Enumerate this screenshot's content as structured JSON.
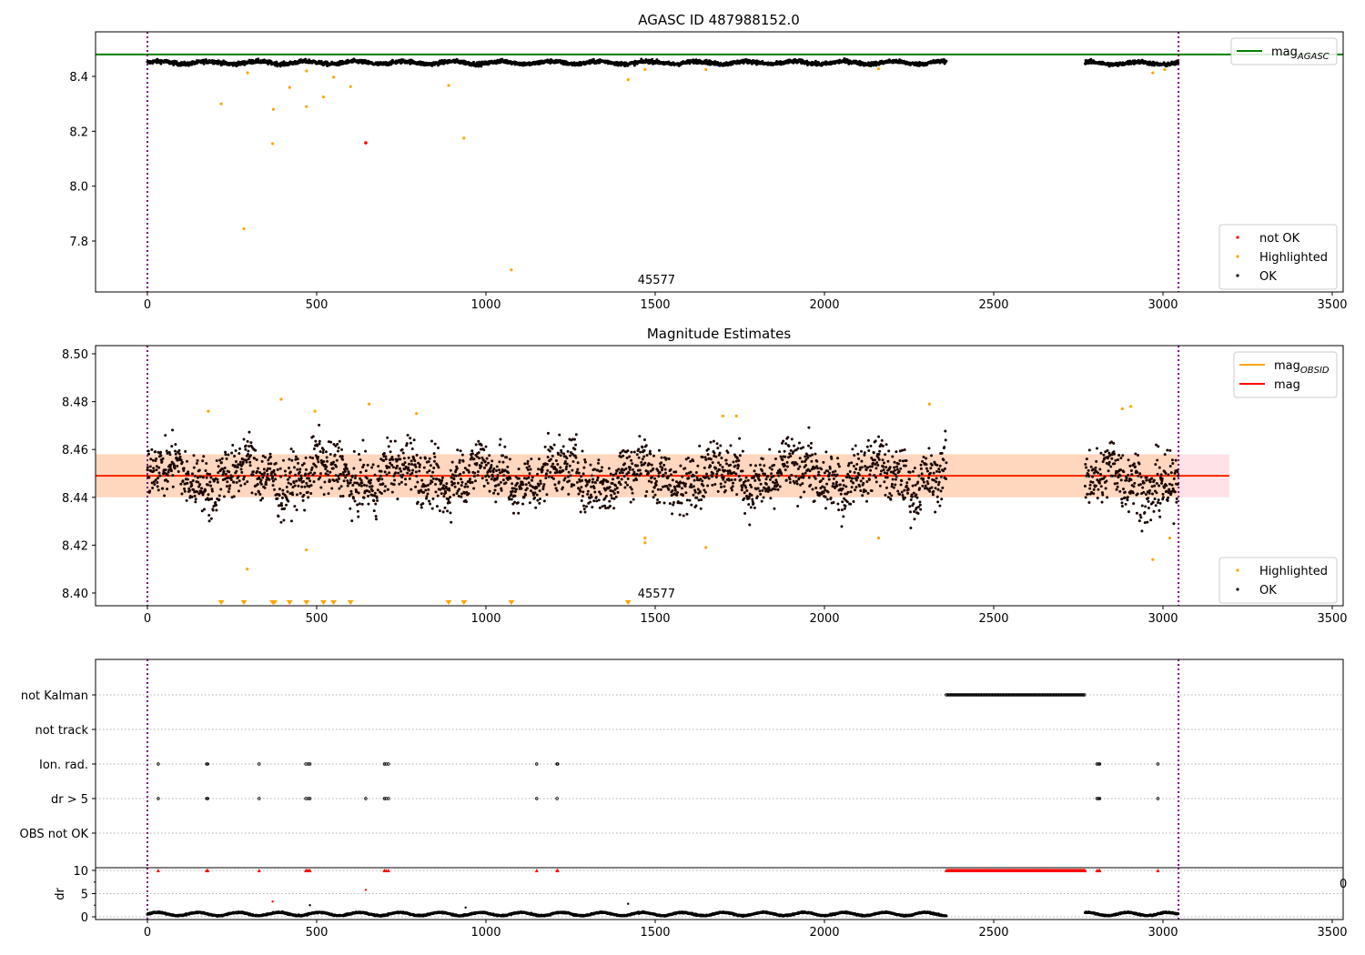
{
  "chart_data": [
    {
      "type": "scatter",
      "title": "AGASC ID 487988152.0",
      "xlim": [
        -150,
        3535
      ],
      "ylim": [
        7.614,
        8.562
      ],
      "xticks": [
        "0",
        "500",
        "1000",
        "1500",
        "2000",
        "2500",
        "3000",
        "3500"
      ],
      "yticks": [
        "7.8",
        "8.0",
        "8.2",
        "8.4"
      ],
      "hline": {
        "name": "mag_AGASC",
        "value": 8.48,
        "color": "#008000"
      },
      "vlines": [
        0,
        3046
      ],
      "annotation": {
        "text": "45577",
        "x": 1450
      },
      "legend_top": [
        {
          "label": "mag",
          "subscript": "AGASC",
          "color": "#008000"
        }
      ],
      "legend_bottom": [
        {
          "label": "not OK",
          "color": "#ff0000"
        },
        {
          "label": "Highlighted",
          "color": "#ffa500"
        },
        {
          "label": "OK",
          "color": "#000000"
        }
      ],
      "ok_segments": [
        {
          "x0": 0,
          "x1": 2360,
          "mean": 8.45,
          "spread": 0.012
        },
        {
          "x0": 2770,
          "x1": 3045,
          "mean": 8.448,
          "spread": 0.012
        }
      ],
      "highlighted": [
        [
          218,
          8.3
        ],
        [
          296,
          8.413
        ],
        [
          372,
          8.28
        ],
        [
          370,
          8.155
        ],
        [
          420,
          8.36
        ],
        [
          470,
          8.29
        ],
        [
          470,
          8.42
        ],
        [
          520,
          8.325
        ],
        [
          550,
          8.397
        ],
        [
          600,
          8.363
        ],
        [
          890,
          8.367
        ],
        [
          935,
          8.175
        ],
        [
          1420,
          8.388
        ],
        [
          285,
          7.845
        ],
        [
          1075,
          7.695
        ],
        [
          1470,
          8.425
        ],
        [
          1650,
          8.425
        ],
        [
          2160,
          8.428
        ],
        [
          2970,
          8.413
        ],
        [
          3005,
          8.425
        ]
      ],
      "not_ok": [
        [
          645,
          8.158
        ]
      ]
    },
    {
      "type": "scatter",
      "title": "Magnitude Estimates",
      "xlim": [
        -150,
        3535
      ],
      "ylim": [
        8.395,
        8.505
      ],
      "xticks": [
        "0",
        "500",
        "1000",
        "1500",
        "2000",
        "2500",
        "3000",
        "3500"
      ],
      "yticks": [
        "8.40",
        "8.42",
        "8.44",
        "8.46",
        "8.48",
        "8.50"
      ],
      "hline": {
        "name": "mag",
        "value": 8.449,
        "color": "#ff0000"
      },
      "band_obsid": {
        "low": 8.44,
        "high": 8.458,
        "x0": 0,
        "x1": 3046,
        "color": "#ffa500"
      },
      "band_mag": {
        "low": 8.44,
        "high": 8.458,
        "x0": -150,
        "x1": 3196,
        "color": "#ff6080"
      },
      "vlines": [
        0,
        3046
      ],
      "annotation": {
        "text": "45577",
        "x": 1450
      },
      "legend_top": [
        {
          "label": "mag",
          "subscript": "OBSID",
          "color": "#ffa500"
        },
        {
          "label": "mag",
          "subscript": "",
          "color": "#ff0000"
        }
      ],
      "legend_bottom": [
        {
          "label": "Highlighted",
          "color": "#ffa500"
        },
        {
          "label": "OK",
          "color": "#000000"
        }
      ],
      "ok_segments": [
        {
          "x0": 0,
          "x1": 2360,
          "mean": 8.449,
          "spread": 0.008
        },
        {
          "x0": 2770,
          "x1": 3045,
          "mean": 8.447,
          "spread": 0.009
        }
      ],
      "highlighted": [
        [
          180,
          8.476
        ],
        [
          395,
          8.481
        ],
        [
          495,
          8.476
        ],
        [
          655,
          8.479
        ],
        [
          795,
          8.475
        ],
        [
          1700,
          8.474
        ],
        [
          1740,
          8.474
        ],
        [
          2310,
          8.479
        ],
        [
          2880,
          8.477
        ],
        [
          2905,
          8.478
        ],
        [
          1470,
          8.423
        ],
        [
          1470,
          8.421
        ],
        [
          1650,
          8.419
        ],
        [
          2160,
          8.423
        ],
        [
          470,
          8.418
        ],
        [
          295,
          8.41
        ],
        [
          2970,
          8.414
        ],
        [
          3020,
          8.423
        ]
      ],
      "below_range_markers": [
        218,
        285,
        370,
        375,
        420,
        470,
        520,
        550,
        600,
        890,
        935,
        1075,
        1420
      ]
    },
    {
      "type": "scatter",
      "categories": [
        "not Kalman",
        "not track",
        "Ion. rad.",
        "dr > 5",
        "OBS not OK"
      ],
      "xlim": [
        -150,
        3535
      ],
      "xticks": [
        "0",
        "500",
        "1000",
        "1500",
        "2000",
        "2500",
        "3000",
        "3500"
      ],
      "flags": {
        "not Kalman": {
          "ranges": [
            [
              2360,
              2770
            ]
          ],
          "points": []
        },
        "not track": {
          "ranges": [],
          "points": []
        },
        "Ion. rad.": {
          "ranges": [],
          "points": [
            32,
            175,
            178,
            330,
            468,
            475,
            480,
            700,
            705,
            712,
            1150,
            1210,
            1212,
            2805,
            2810,
            2813,
            2985
          ]
        },
        "dr > 5": {
          "ranges": [],
          "points": [
            32,
            175,
            178,
            330,
            468,
            475,
            480,
            645,
            700,
            705,
            712,
            1150,
            1210,
            2805,
            2810,
            2813,
            2985
          ]
        },
        "OBS not OK": {
          "ranges": [],
          "points": []
        }
      },
      "dr": {
        "ylabel": "dr",
        "yticks": [
          "0",
          "5",
          "10"
        ],
        "ylim": [
          -0.5,
          10.5
        ],
        "clipped_at_10": {
          "ranges": [
            [
              2360,
              2770
            ]
          ],
          "points": [
            32,
            175,
            178,
            330,
            468,
            472,
            476,
            480,
            700,
            705,
            712,
            1150,
            1210,
            1212,
            2805,
            2810,
            2813,
            2985
          ]
        },
        "not_ok": [
          [
            370,
            3.3
          ],
          [
            645,
            5.8
          ]
        ],
        "outliers": [
          [
            480,
            2.5
          ],
          [
            940,
            2.0
          ],
          [
            1420,
            2.8
          ]
        ],
        "ok_segments": [
          {
            "x0": 0,
            "x1": 2360,
            "mean": 0.6
          },
          {
            "x0": 2770,
            "x1": 3045,
            "mean": 0.6
          }
        ]
      },
      "stray_tick_fragment": "0"
    }
  ]
}
